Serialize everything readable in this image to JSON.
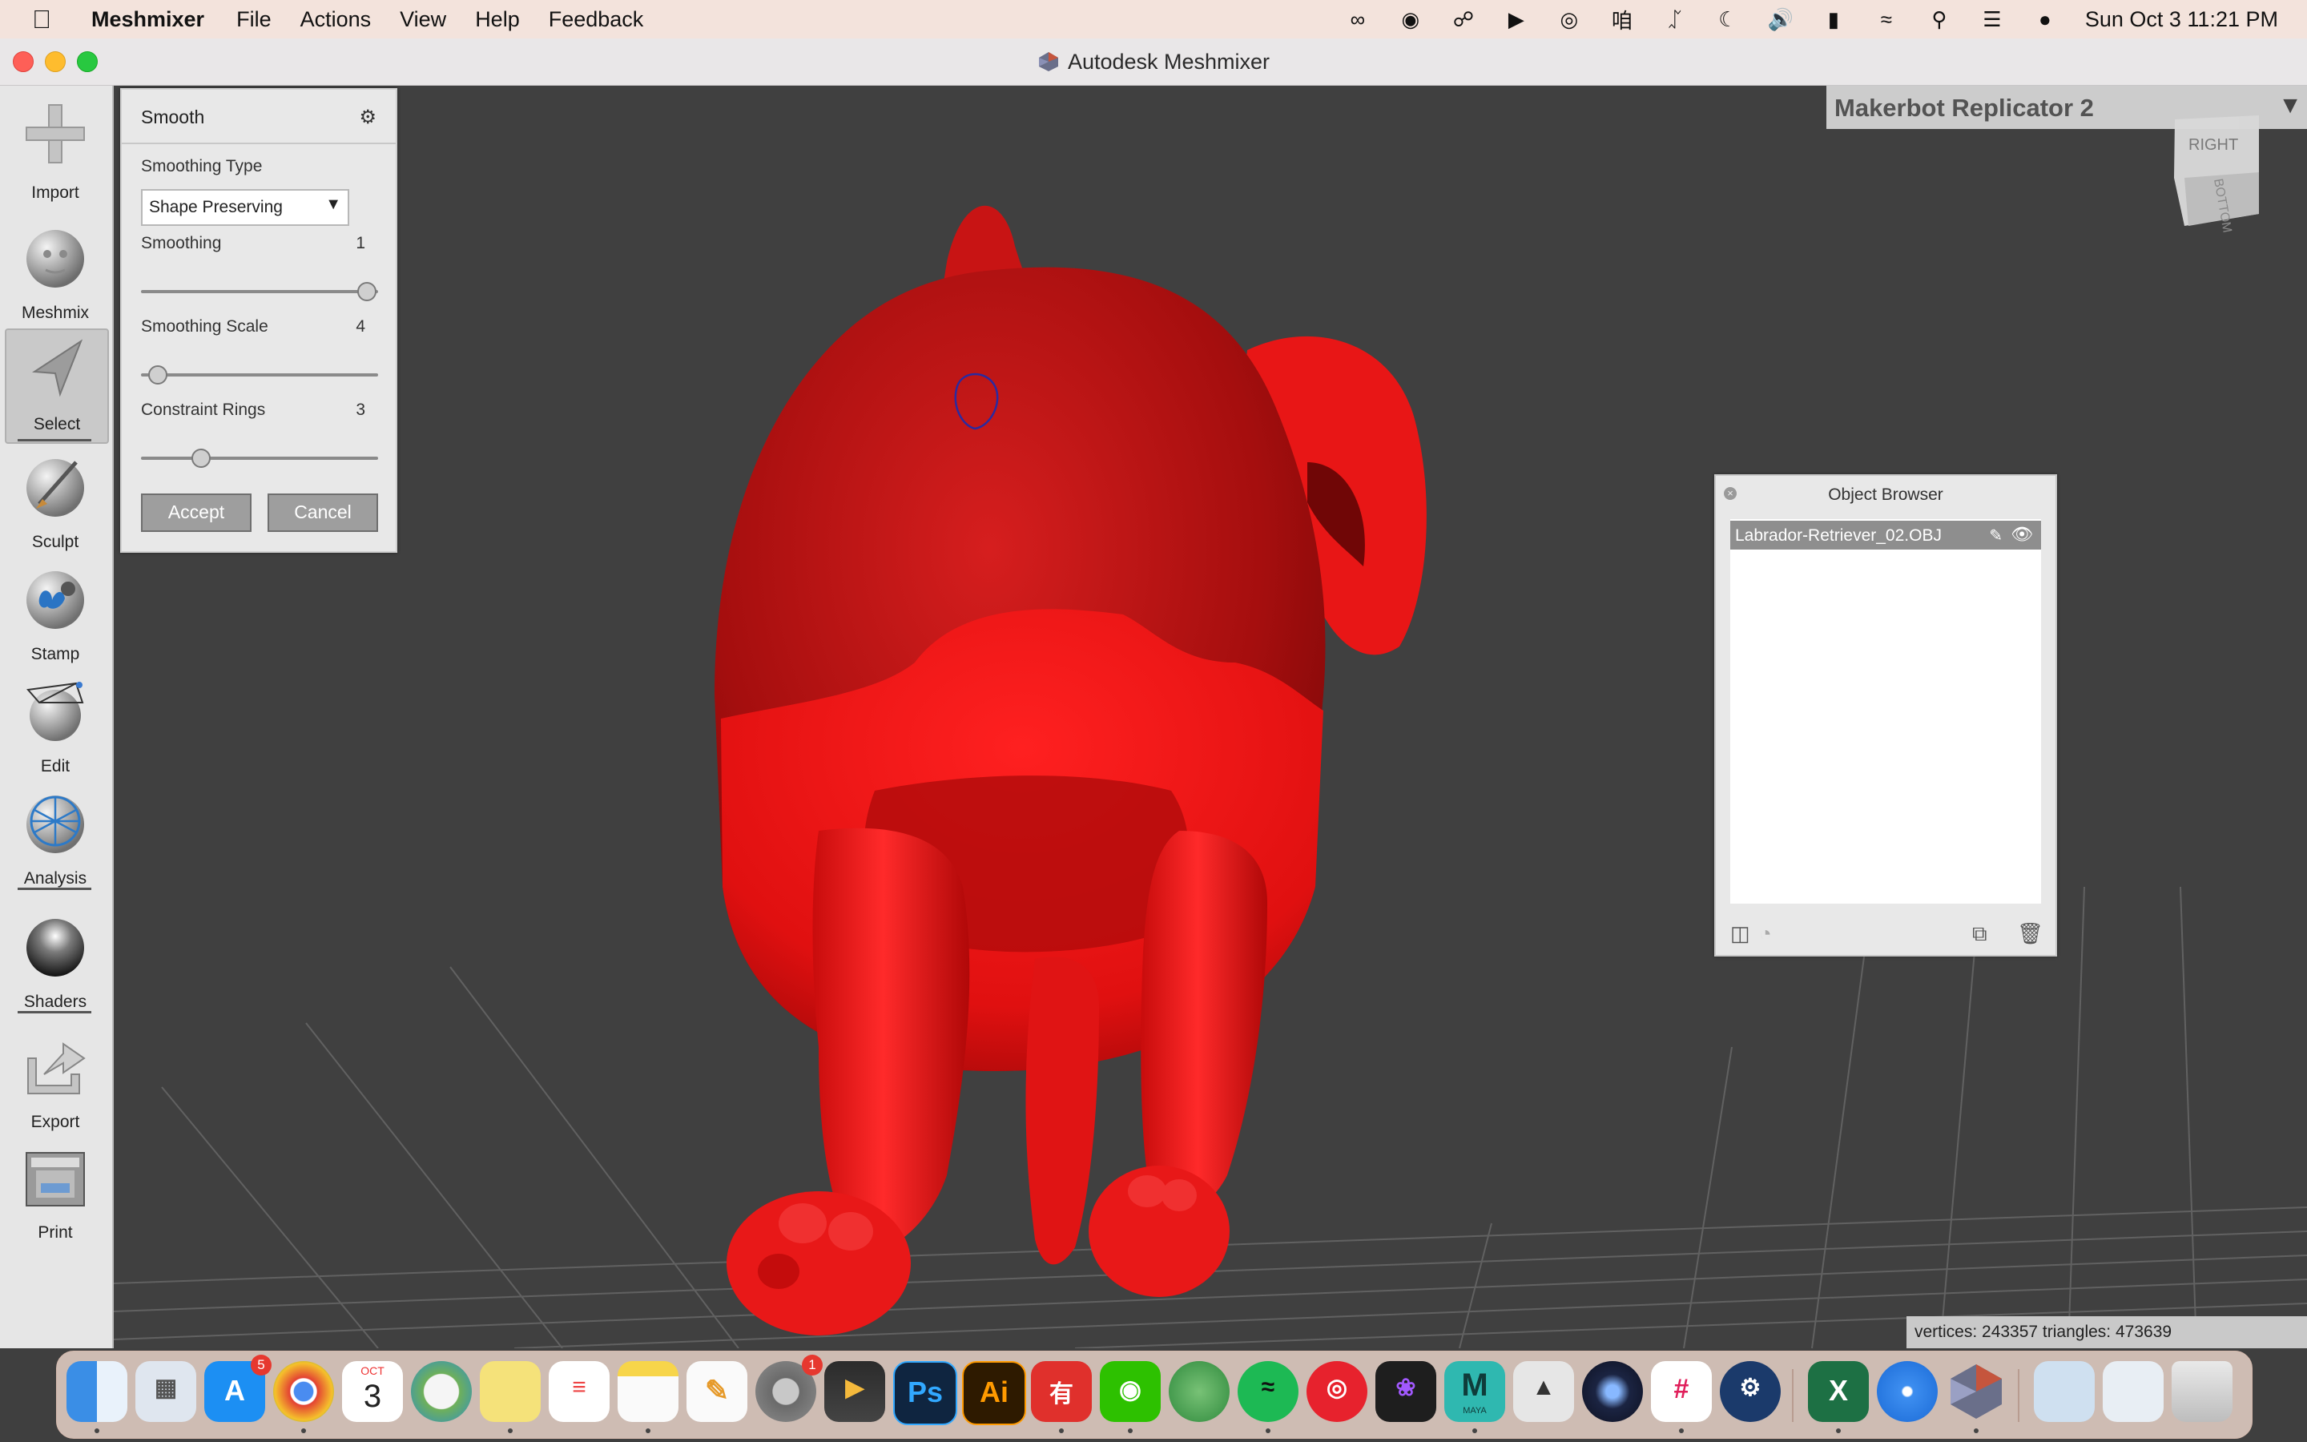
{
  "menubar": {
    "app_name": "Meshmixer",
    "items": [
      "File",
      "Actions",
      "View",
      "Help",
      "Feedback"
    ],
    "clock": "Sun Oct 3  11:21 PM"
  },
  "window": {
    "title": "Autodesk Meshmixer"
  },
  "toolbar": {
    "tools": [
      {
        "label": "Import",
        "icon": "plus-icon"
      },
      {
        "label": "Meshmix",
        "icon": "meshmix-head-icon"
      },
      {
        "label": "Select",
        "icon": "select-arrow-icon",
        "active": true
      },
      {
        "label": "Sculpt",
        "icon": "sculpt-brush-icon"
      },
      {
        "label": "Stamp",
        "icon": "stamp-icon"
      },
      {
        "label": "Edit",
        "icon": "edit-sphere-icon"
      },
      {
        "label": "Analysis",
        "icon": "analysis-sphere-icon"
      },
      {
        "label": "Shaders",
        "icon": "shader-sphere-icon"
      },
      {
        "label": "Export",
        "icon": "export-icon"
      },
      {
        "label": "Print",
        "icon": "printer-icon"
      }
    ]
  },
  "smooth_panel": {
    "title": "Smooth",
    "smoothing_type_label": "Smoothing Type",
    "smoothing_type_value": "Shape Preserving",
    "smoothing_label": "Smoothing",
    "smoothing_value": "1",
    "smoothing_fraction": 1.0,
    "smoothing_scale_label": "Smoothing Scale",
    "smoothing_scale_value": "4",
    "smoothing_scale_fraction": 0.04,
    "constraint_rings_label": "Constraint Rings",
    "constraint_rings_value": "3",
    "constraint_rings_fraction": 0.24,
    "accept_label": "Accept",
    "cancel_label": "Cancel"
  },
  "viewport": {
    "printer": "Makerbot Replicator 2",
    "view_cube_faces": [
      "RIGHT",
      "BOTTOM"
    ],
    "stats": "vertices: 243357 triangles: 473639",
    "model_color": "#e61010"
  },
  "object_browser": {
    "title": "Object Browser",
    "items": [
      {
        "name": "Labrador-Retriever_02.OBJ"
      }
    ]
  },
  "dock": {
    "apps": [
      "Finder",
      "Launchpad",
      "App Store",
      "Chrome",
      "Calendar",
      "VPN",
      "Stickies",
      "Reminders",
      "Notes",
      "Pencil",
      "System Preferences",
      "Final Cut Pro",
      "Photoshop",
      "Illustrator",
      "Youdao",
      "WeChat",
      "Maps",
      "Spotify",
      "NetEase Music",
      "Figma",
      "Maya",
      "Rhino",
      "Cinema 4D",
      "Slack",
      "Steam",
      "Excel",
      "Safari",
      "Meshmixer",
      "Downloads",
      "Documents",
      "Trash"
    ],
    "app_store_badge": "5",
    "system_prefs_badge": "1",
    "calendar_month": "OCT",
    "calendar_day": "3",
    "maya_label": "MAYA"
  }
}
